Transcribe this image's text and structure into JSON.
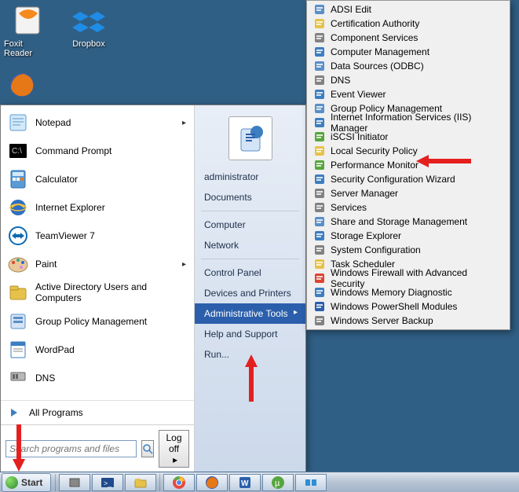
{
  "desktop_icons": [
    {
      "label": "Foxit Reader",
      "icon": "foxit"
    },
    {
      "label": "Dropbox",
      "icon": "dropbox"
    }
  ],
  "start_menu": {
    "left_programs": [
      {
        "label": "Notepad",
        "has_arrow": true,
        "icon": "notepad"
      },
      {
        "label": "Command Prompt",
        "icon": "cmd"
      },
      {
        "label": "Calculator",
        "icon": "calc"
      },
      {
        "label": "Internet Explorer",
        "icon": "ie"
      },
      {
        "label": "TeamViewer 7",
        "icon": "teamviewer"
      },
      {
        "label": "Paint",
        "has_arrow": true,
        "icon": "paint"
      },
      {
        "label": "Active Directory Users and Computers",
        "icon": "aduc"
      },
      {
        "label": "Group Policy Management",
        "icon": "gpm"
      },
      {
        "label": "WordPad",
        "icon": "wordpad"
      },
      {
        "label": "DNS",
        "icon": "dns"
      }
    ],
    "all_programs_label": "All Programs",
    "search_placeholder": "Search programs and files",
    "logoff_label": "Log off",
    "right_panel": {
      "username": "administrator",
      "items": [
        {
          "label": "Documents"
        },
        {
          "label": "Computer"
        },
        {
          "label": "Network"
        },
        {
          "label": "Control Panel"
        },
        {
          "label": "Devices and Printers"
        },
        {
          "label": "Administrative Tools",
          "selected": true
        },
        {
          "label": "Help and Support"
        },
        {
          "label": "Run..."
        }
      ]
    }
  },
  "admin_tools_menu": [
    "ADSI Edit",
    "Certification Authority",
    "Component Services",
    "Computer Management",
    "Data Sources (ODBC)",
    "DNS",
    "Event Viewer",
    "Group Policy Management",
    "Internet Information Services (IIS) Manager",
    "iSCSI Initiator",
    "Local Security Policy",
    "Performance Monitor",
    "Security Configuration Wizard",
    "Server Manager",
    "Services",
    "Share and Storage Management",
    "Storage Explorer",
    "System Configuration",
    "Task Scheduler",
    "Windows Firewall with Advanced Security",
    "Windows Memory Diagnostic",
    "Windows PowerShell Modules",
    "Windows Server Backup"
  ],
  "taskbar": {
    "start_label": "Start"
  },
  "icon_colors": {
    "foxit": "#F58A1F",
    "dropbox": "#1F8CE6",
    "notepad": "#6FB8E8",
    "cmd": "#000000",
    "calc": "#4A8AC9",
    "ie": "#2E6FC1",
    "teamviewer": "#0E6BB3",
    "paint": "#E67A1F",
    "aduc": "#E6C24A",
    "gpm": "#5B8FC7",
    "wordpad": "#3D7EC1",
    "dns": "#828282",
    "firefox": "#E67817",
    "chrome": "#E84A3D",
    "word": "#2B5FAB",
    "utorrent": "#56A63E",
    "explorer": "#E6C24A",
    "server": "#828282",
    "powershell": "#1F4A8C",
    "monitor": "#2F8FD4"
  }
}
